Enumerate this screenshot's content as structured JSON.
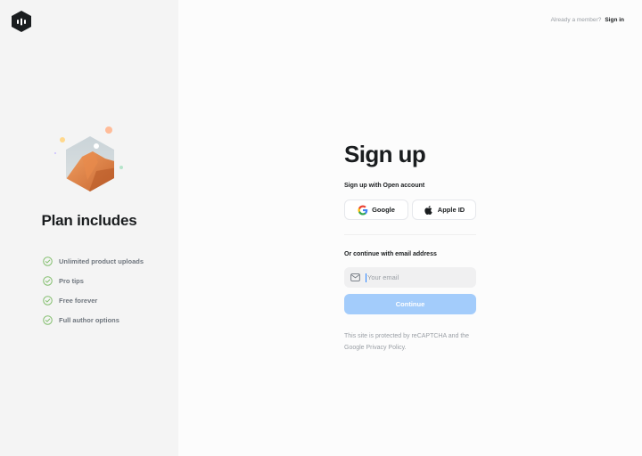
{
  "header": {
    "member_text": "Already a member?",
    "signin_label": "Sign in"
  },
  "left": {
    "plan_title": "Plan includes",
    "features": [
      "Unlimited product uploads",
      "Pro tips",
      "Free forever",
      "Full author options"
    ],
    "check_color": "#83bf6e"
  },
  "form": {
    "title": "Sign up",
    "subtitle": "Sign up with Open account",
    "google_label": "Google",
    "apple_label": "Apple ID",
    "email_label": "Or continue with email address",
    "email_placeholder": "Your email",
    "email_value": "",
    "continue_label": "Continue",
    "legal_text": "This site is protected by reCAPTCHA and the Google Privacy Policy."
  },
  "colors": {
    "accent": "#2a85ff",
    "button_disabled": "#a3ccfb",
    "left_bg": "#f4f4f4"
  }
}
